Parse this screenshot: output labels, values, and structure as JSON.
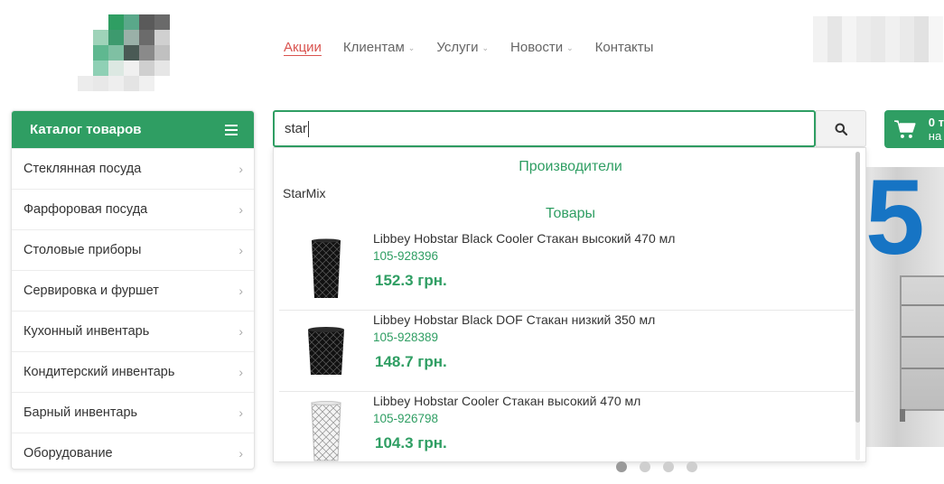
{
  "nav": {
    "items": [
      {
        "label": "Акции",
        "active": true,
        "dropdown": false
      },
      {
        "label": "Клиентам",
        "active": false,
        "dropdown": true
      },
      {
        "label": "Услуги",
        "active": false,
        "dropdown": true
      },
      {
        "label": "Новости",
        "active": false,
        "dropdown": true
      },
      {
        "label": "Контакты",
        "active": false,
        "dropdown": false
      }
    ]
  },
  "catalog": {
    "title": "Каталог товаров",
    "items": [
      {
        "label": "Стеклянная посуда"
      },
      {
        "label": "Фарфоровая посуда"
      },
      {
        "label": "Столовые приборы"
      },
      {
        "label": "Сервировка и фуршет"
      },
      {
        "label": "Кухонный инвентарь"
      },
      {
        "label": "Кондитерский инвентарь"
      },
      {
        "label": "Барный инвентарь"
      },
      {
        "label": "Оборудование"
      }
    ]
  },
  "search": {
    "value": "star"
  },
  "cart": {
    "count_text": "0 т",
    "sub_text": "на"
  },
  "banner": {
    "promo_text": "5"
  },
  "dropdown": {
    "manufacturers_heading": "Производители",
    "manufacturers": [
      "StarMix"
    ],
    "products_heading": "Товары",
    "products": [
      {
        "name": "Libbey Hobstar Black Cooler Стакан высокий 470 мл",
        "sku": "105-928396",
        "price": "152.3 грн.",
        "color": "dark",
        "shape": "tall"
      },
      {
        "name": "Libbey Hobstar Black DOF Стакан низкий 350 мл",
        "sku": "105-928389",
        "price": "148.7 грн.",
        "color": "dark",
        "shape": "short"
      },
      {
        "name": "Libbey Hobstar Cooler Стакан высокий 470 мл",
        "sku": "105-926798",
        "price": "104.3 грн.",
        "color": "clear",
        "shape": "tall"
      }
    ]
  },
  "carousel": {
    "dots": 4,
    "active_index": 0
  },
  "colors": {
    "brand_green": "#2f9e63",
    "active_nav": "#d9534f",
    "banner_blue": "#1674c4"
  }
}
